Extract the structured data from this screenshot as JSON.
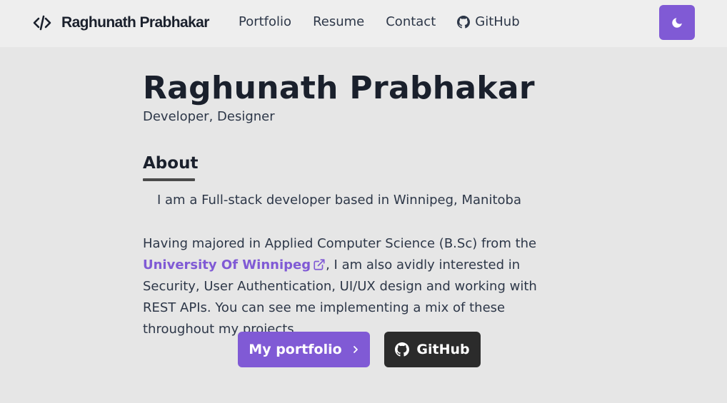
{
  "navbar": {
    "brand_name": "Raghunath Prabhakar",
    "brand_icon": "code-icon",
    "links": [
      {
        "label": "Portfolio"
      },
      {
        "label": "Resume"
      },
      {
        "label": "Contact"
      },
      {
        "label": "GitHub",
        "icon": "github-icon"
      }
    ],
    "theme_toggle_icon": "moon-icon"
  },
  "hero": {
    "title": "Raghunath Prabhakar",
    "subtitle": "Developer, Designer"
  },
  "about": {
    "heading": "About",
    "intro": "I am a Full-stack developer based in Winnipeg, Manitoba",
    "bio_before_link": "Having majored in Applied Computer Science (B.Sc) from the ",
    "university_link": "University Of Winnipeg",
    "bio_after_link": ", I am also avidly interested in Security, User Authentication, UI/UX design and working with REST APIs. You can see me implementing a mix of these throughout my projects"
  },
  "actions": {
    "portfolio_label": "My portfolio",
    "github_label": "GitHub"
  },
  "colors": {
    "accent": "#805ad5",
    "background": "#e6e6e6",
    "navbar_bg": "#eeeeee",
    "dark_button": "#2b2b2b"
  }
}
